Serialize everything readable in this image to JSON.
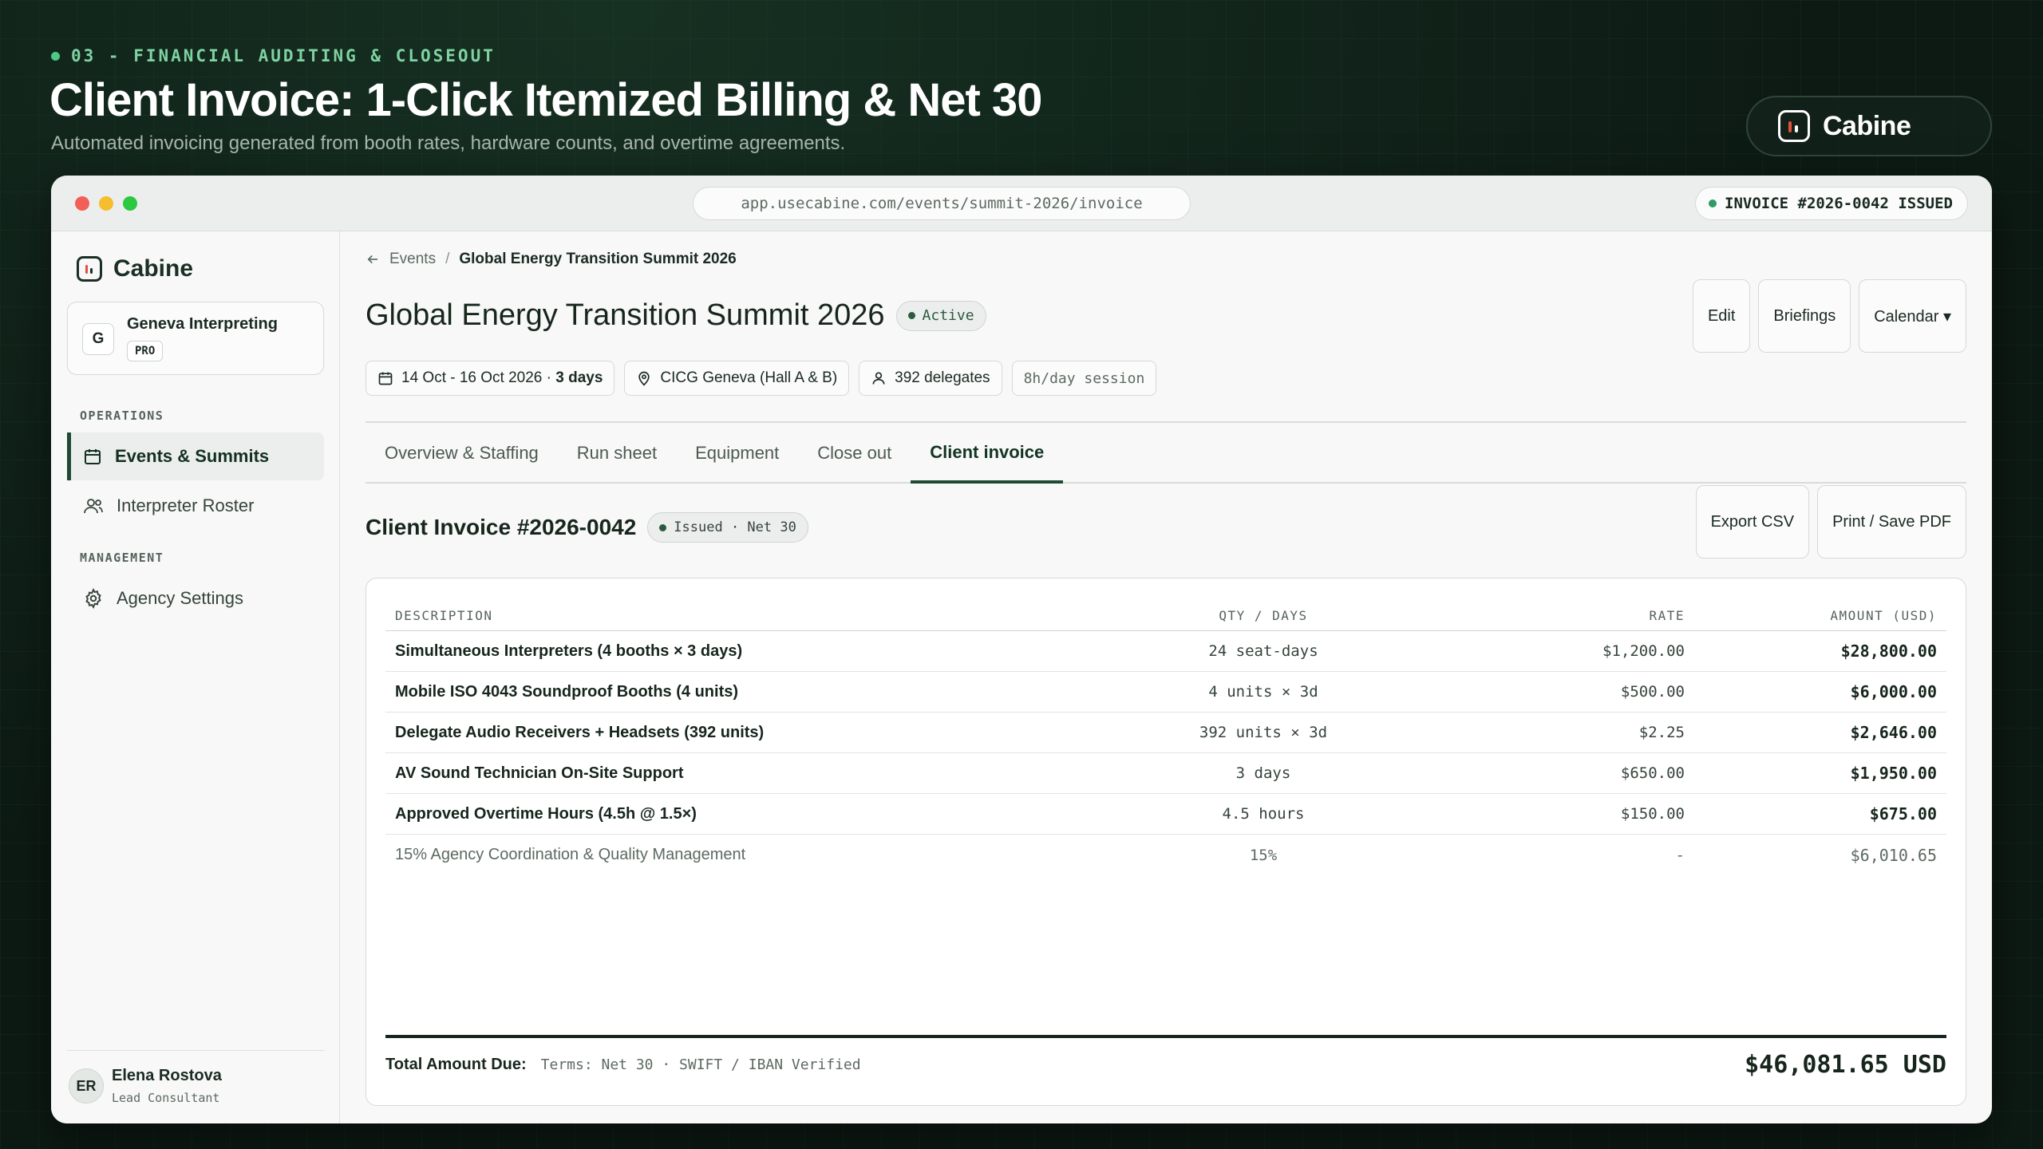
{
  "hero": {
    "eyebrow": "03 - FINANCIAL AUDITING & CLOSEOUT",
    "title": "Client Invoice: 1-Click Itemized Billing & Net 30",
    "subtitle": "Automated invoicing generated from booth rates, hardware counts, and overtime agreements.",
    "brand": "Cabine"
  },
  "window": {
    "url": "app.usecabine.com/events/summit-2026/invoice",
    "badge": "INVOICE #2026-0042 ISSUED"
  },
  "sidebar": {
    "brand": "Cabine",
    "org": {
      "initial": "G",
      "name": "Geneva Interpreting",
      "plan": "PRO"
    },
    "sections": [
      {
        "label": "OPERATIONS"
      },
      {
        "label": "MANAGEMENT"
      }
    ],
    "items": [
      {
        "label": "Events & Summits",
        "icon": "calendar-icon"
      },
      {
        "label": "Interpreter Roster",
        "icon": "users-icon"
      },
      {
        "label": "Agency Settings",
        "icon": "gear-icon"
      }
    ],
    "user": {
      "initials": "ER",
      "name": "Elena Rostova",
      "role": "Lead Consultant"
    }
  },
  "main": {
    "breadcrumb": {
      "parent": "Events",
      "separator": "/",
      "current": "Global Energy Transition Summit 2026"
    },
    "title": "Global Energy Transition Summit 2026",
    "status": "Active",
    "actions": {
      "edit": "Edit",
      "briefings": "Briefings",
      "calendar": "Calendar ▾"
    },
    "meta": {
      "dates": "14 Oct - 16 Oct 2026 · ",
      "duration": "3 days",
      "venue": "CICG Geneva (Hall A & B)",
      "delegates": "392 delegates",
      "session": "8h/day session"
    },
    "tabs": [
      {
        "label": "Overview & Staffing"
      },
      {
        "label": "Run sheet"
      },
      {
        "label": "Equipment"
      },
      {
        "label": "Close out"
      },
      {
        "label": "Client invoice"
      }
    ],
    "active_tab": "Client invoice"
  },
  "invoice": {
    "title": "Client Invoice #2026-0042",
    "status": "Issued · Net 30",
    "export_label": "Export CSV",
    "print_label": "Print / Save PDF",
    "columns": {
      "description": "DESCRIPTION",
      "qty": "QTY / DAYS",
      "rate": "RATE",
      "amount": "AMOUNT (USD)"
    },
    "rows": [
      {
        "description": "Simultaneous Interpreters (4 booths × 3 days)",
        "qty": "24 seat-days",
        "rate": "$1,200.00",
        "amount": "$28,800.00"
      },
      {
        "description": "Mobile ISO 4043 Soundproof Booths (4 units)",
        "qty": "4 units × 3d",
        "rate": "$500.00",
        "amount": "$6,000.00"
      },
      {
        "description": "Delegate Audio Receivers + Headsets (392 units)",
        "qty": "392 units × 3d",
        "rate": "$2.25",
        "amount": "$2,646.00"
      },
      {
        "description": "AV Sound Technician On-Site Support",
        "qty": "3 days",
        "rate": "$650.00",
        "amount": "$1,950.00"
      },
      {
        "description": "Approved Overtime Hours (4.5h @ 1.5×)",
        "qty": "4.5 hours",
        "rate": "$150.00",
        "amount": "$675.00"
      }
    ],
    "fee": {
      "description": "15% Agency Coordination & Quality Management",
      "qty": "15%",
      "rate": "-",
      "amount": "$6,010.65"
    },
    "total_label": "Total Amount Due:",
    "terms": "Terms: Net 30 · SWIFT / IBAN Verified",
    "total": "$46,081.65 USD"
  },
  "colors": {
    "accent": "#1f4a33",
    "status_green": "#2f9a63",
    "logo_red": "#e0523a"
  }
}
